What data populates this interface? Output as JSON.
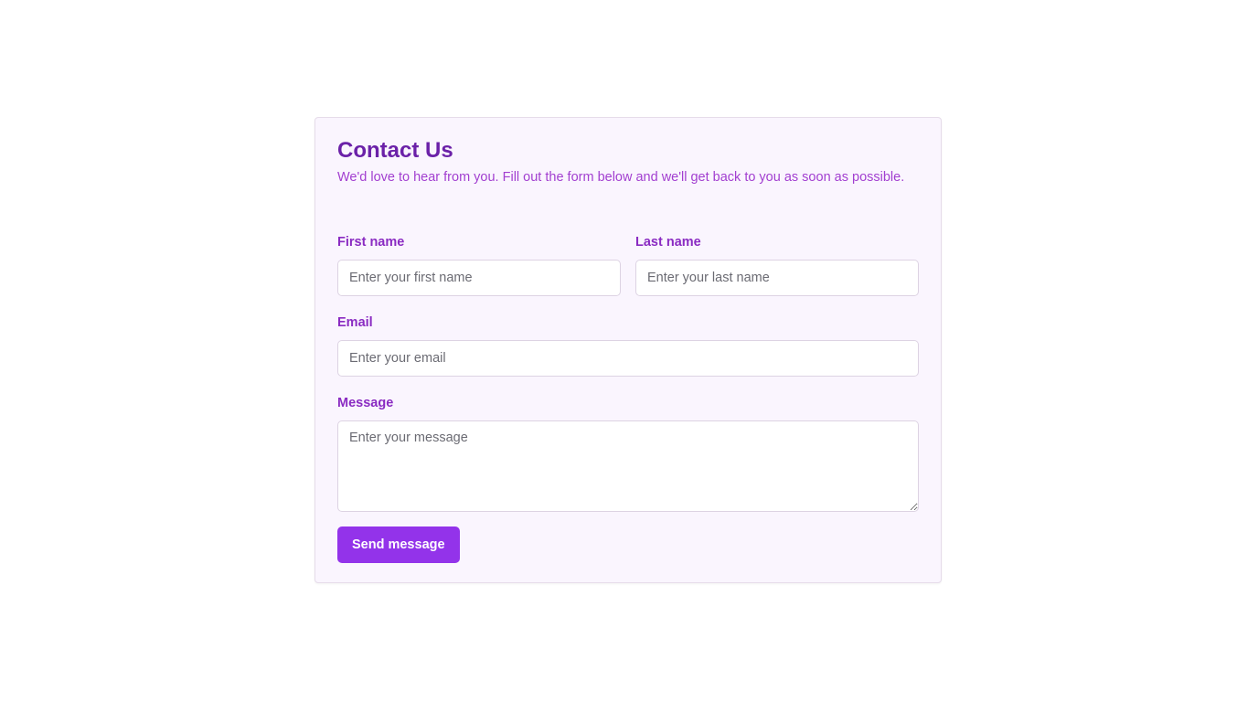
{
  "form": {
    "title": "Contact Us",
    "subtitle": "We'd love to hear from you. Fill out the form below and we'll get back to you as soon as possible.",
    "first_name": {
      "label": "First name",
      "placeholder": "Enter your first name",
      "value": ""
    },
    "last_name": {
      "label": "Last name",
      "placeholder": "Enter your last name",
      "value": ""
    },
    "email": {
      "label": "Email",
      "placeholder": "Enter your email",
      "value": ""
    },
    "message": {
      "label": "Message",
      "placeholder": "Enter your message",
      "value": ""
    },
    "submit_label": "Send message"
  },
  "colors": {
    "accent": "#9333ea",
    "title": "#6b21a8",
    "card_background": "#faf5fe"
  }
}
